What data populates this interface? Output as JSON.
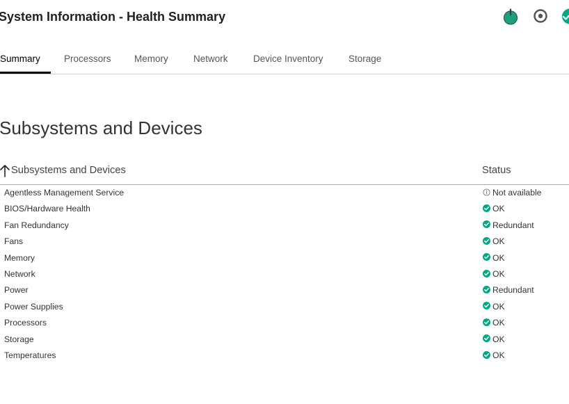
{
  "header": {
    "title": "System Information - Health Summary",
    "icons": {
      "power": "power-icon",
      "uid": "uid-indicator-icon",
      "health": "health-status-icon"
    }
  },
  "tabs": [
    {
      "label": "Summary",
      "active": true
    },
    {
      "label": "Processors",
      "active": false
    },
    {
      "label": "Memory",
      "active": false
    },
    {
      "label": "Network",
      "active": false
    },
    {
      "label": "Device Inventory",
      "active": false
    },
    {
      "label": "Storage",
      "active": false
    }
  ],
  "section": {
    "title": "Subsystems and Devices"
  },
  "table": {
    "sort_icon": "sort-ascending-icon",
    "columns": {
      "name": "Subsystems and Devices",
      "status": "Status"
    },
    "rows": [
      {
        "name": "Agentless Management Service",
        "status": "Not available",
        "icon": "info-icon"
      },
      {
        "name": "BIOS/Hardware Health",
        "status": "OK",
        "icon": "check-circle-icon"
      },
      {
        "name": "Fan Redundancy",
        "status": "Redundant",
        "icon": "check-circle-icon"
      },
      {
        "name": "Fans",
        "status": "OK",
        "icon": "check-circle-icon"
      },
      {
        "name": "Memory",
        "status": "OK",
        "icon": "check-circle-icon"
      },
      {
        "name": "Network",
        "status": "OK",
        "icon": "check-circle-icon"
      },
      {
        "name": "Power",
        "status": "Redundant",
        "icon": "check-circle-icon"
      },
      {
        "name": "Power Supplies",
        "status": "OK",
        "icon": "check-circle-icon"
      },
      {
        "name": "Processors",
        "status": "OK",
        "icon": "check-circle-icon"
      },
      {
        "name": "Storage",
        "status": "OK",
        "icon": "check-circle-icon"
      },
      {
        "name": "Temperatures",
        "status": "OK",
        "icon": "check-circle-icon"
      }
    ]
  },
  "colors": {
    "status_ok": "#01a982",
    "status_info": "#777777"
  }
}
